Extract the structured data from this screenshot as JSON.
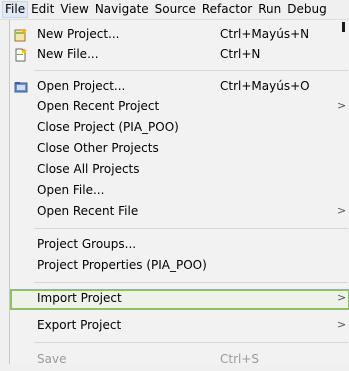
{
  "menubar": {
    "items": [
      "File",
      "Edit",
      "View",
      "Navigate",
      "Source",
      "Refactor",
      "Run",
      "Debug"
    ]
  },
  "menu": {
    "new_project": {
      "label": "New Project...",
      "shortcut": "Ctrl+Mayús+N"
    },
    "new_file": {
      "label": "New File...",
      "shortcut": "Ctrl+N"
    },
    "open_project": {
      "label": "Open Project...",
      "shortcut": "Ctrl+Mayús+O"
    },
    "open_recent_project": {
      "label": "Open Recent Project"
    },
    "close_project": {
      "label": "Close Project (PIA_POO)"
    },
    "close_other_projects": {
      "label": "Close Other Projects"
    },
    "close_all_projects": {
      "label": "Close All Projects"
    },
    "open_file": {
      "label": "Open File..."
    },
    "open_recent_file": {
      "label": "Open Recent File"
    },
    "project_groups": {
      "label": "Project Groups..."
    },
    "project_properties": {
      "label": "Project Properties (PIA_POO)"
    },
    "import_project": {
      "label": "Import Project"
    },
    "export_project": {
      "label": "Export Project"
    },
    "save": {
      "label": "Save",
      "shortcut": "Ctrl+S"
    },
    "submenu_arrow": ">"
  },
  "colors": {
    "highlight_border": "#8ebf6a",
    "disabled_text": "#9a9a9a"
  }
}
